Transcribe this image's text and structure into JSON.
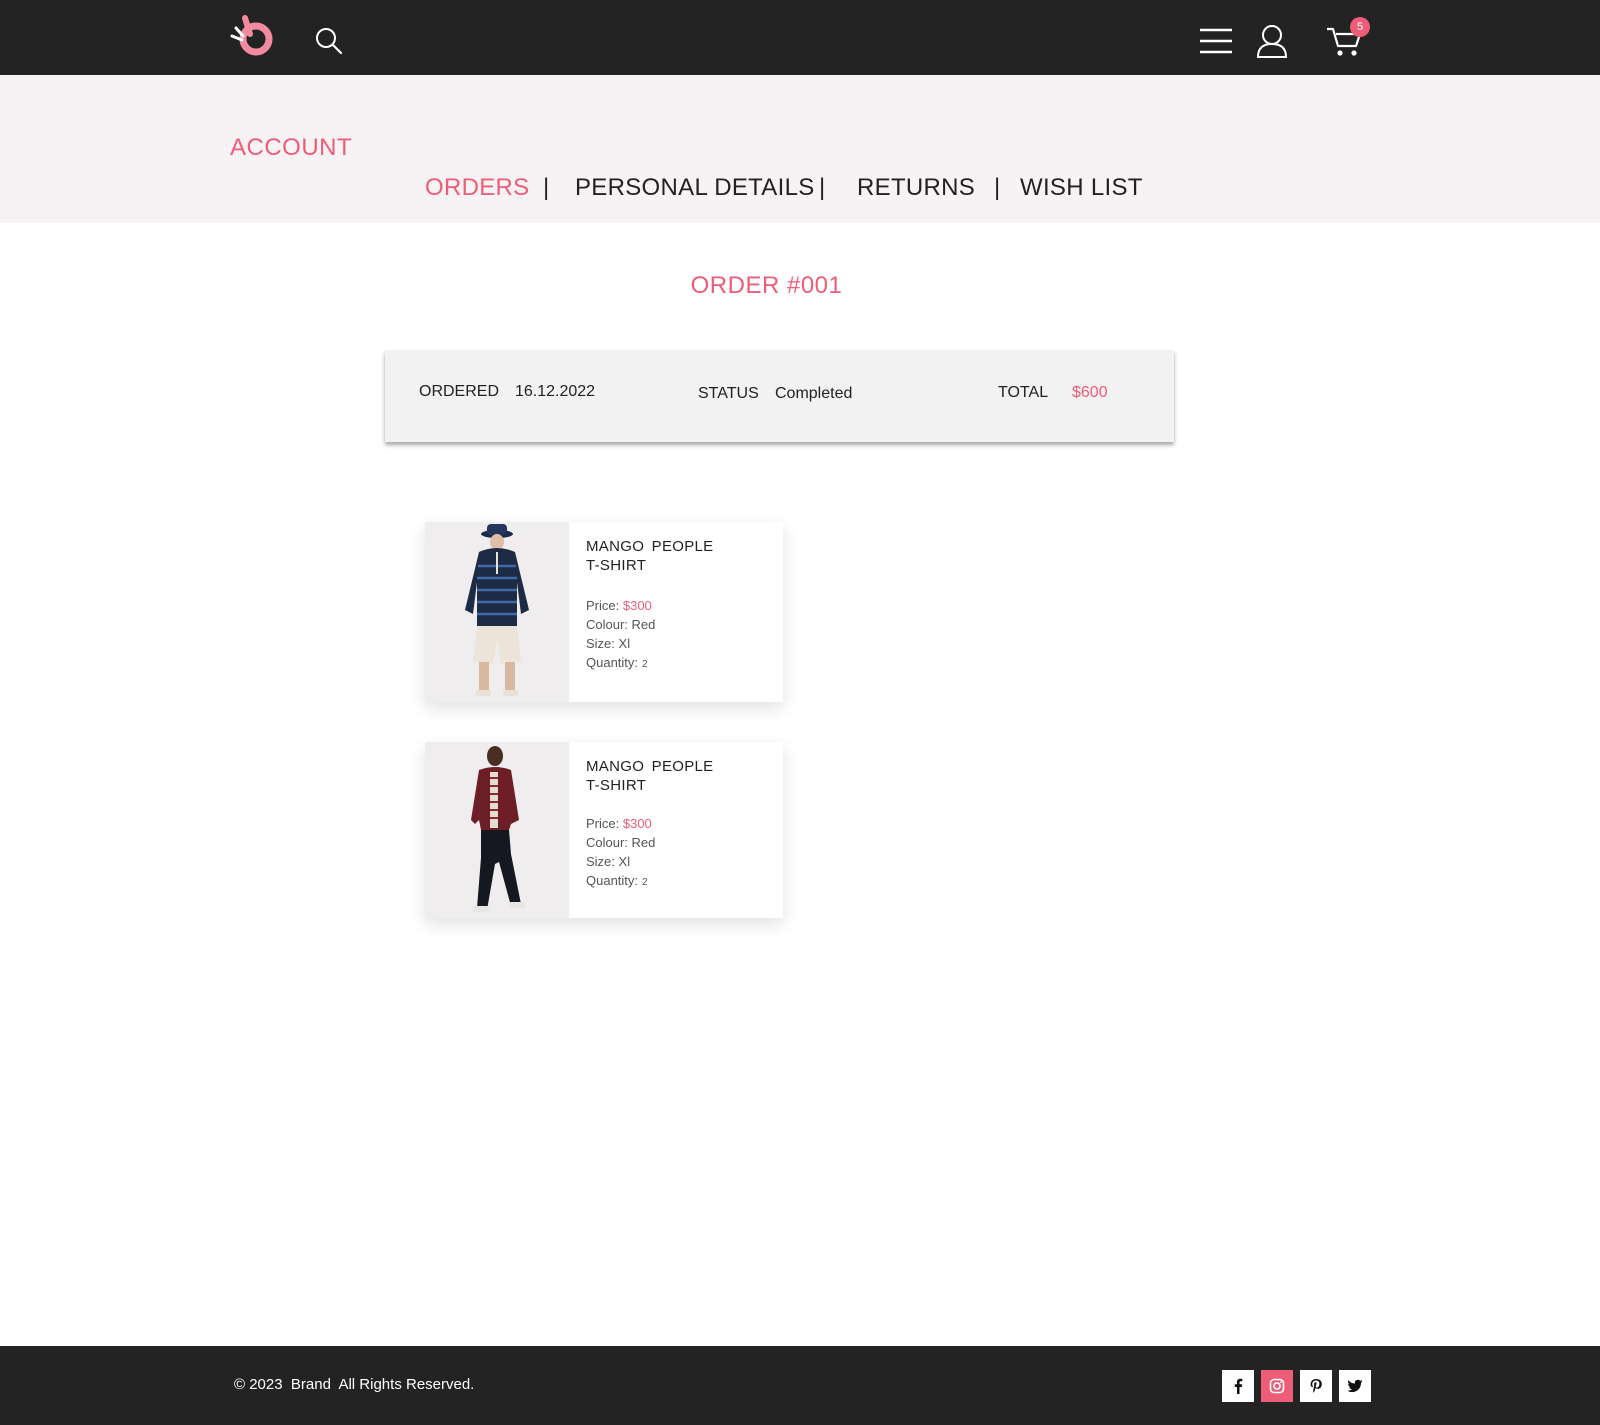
{
  "header": {
    "logo_icon": "brand-logo",
    "search_icon": "search-icon",
    "menu_icon": "hamburger-menu-icon",
    "user_icon": "user-icon",
    "cart_icon": "cart-icon",
    "cart_count": "5"
  },
  "account": {
    "title": "ACCOUNT",
    "tabs": [
      {
        "label": "ORDERS",
        "active": true
      },
      {
        "label": "PERSONAL DETAILS",
        "active": false
      },
      {
        "label": "RETURNS",
        "active": false
      },
      {
        "label": "WISH LIST",
        "active": false
      }
    ],
    "separator": "|"
  },
  "order": {
    "title": "ORDER #001",
    "ordered_label": "ORDERED",
    "ordered_value": "16.12.2022",
    "status_label": "STATUS",
    "status_value": "Completed",
    "total_label": "TOTAL",
    "total_value": "$600"
  },
  "items": [
    {
      "name_line1": "MANGO  PEOPLE",
      "name_line2": "T-SHIRT",
      "price_label": "Price:",
      "price_value": "$300",
      "colour_label": "Colour:",
      "colour_value": "Red",
      "size_label": "Size:",
      "size_value": "Xl",
      "quantity_label": "Quantity:",
      "quantity_value": "2"
    },
    {
      "name_line1": "MANGO  PEOPLE",
      "name_line2": "T-SHIRT",
      "price_label": "Price:",
      "price_value": "$300",
      "colour_label": "Colour:",
      "colour_value": "Red",
      "size_label": "Size:",
      "size_value": "Xl",
      "quantity_label": "Quantity:",
      "quantity_value": "2"
    }
  ],
  "footer": {
    "copyright": "© 2023  Brand  All Rights Reserved.",
    "social": [
      "facebook-icon",
      "instagram-icon",
      "pinterest-icon",
      "twitter-icon"
    ]
  },
  "colors": {
    "accent": "#ee5d78",
    "header_bg": "#232323",
    "band_bg": "#f7f3f4"
  }
}
